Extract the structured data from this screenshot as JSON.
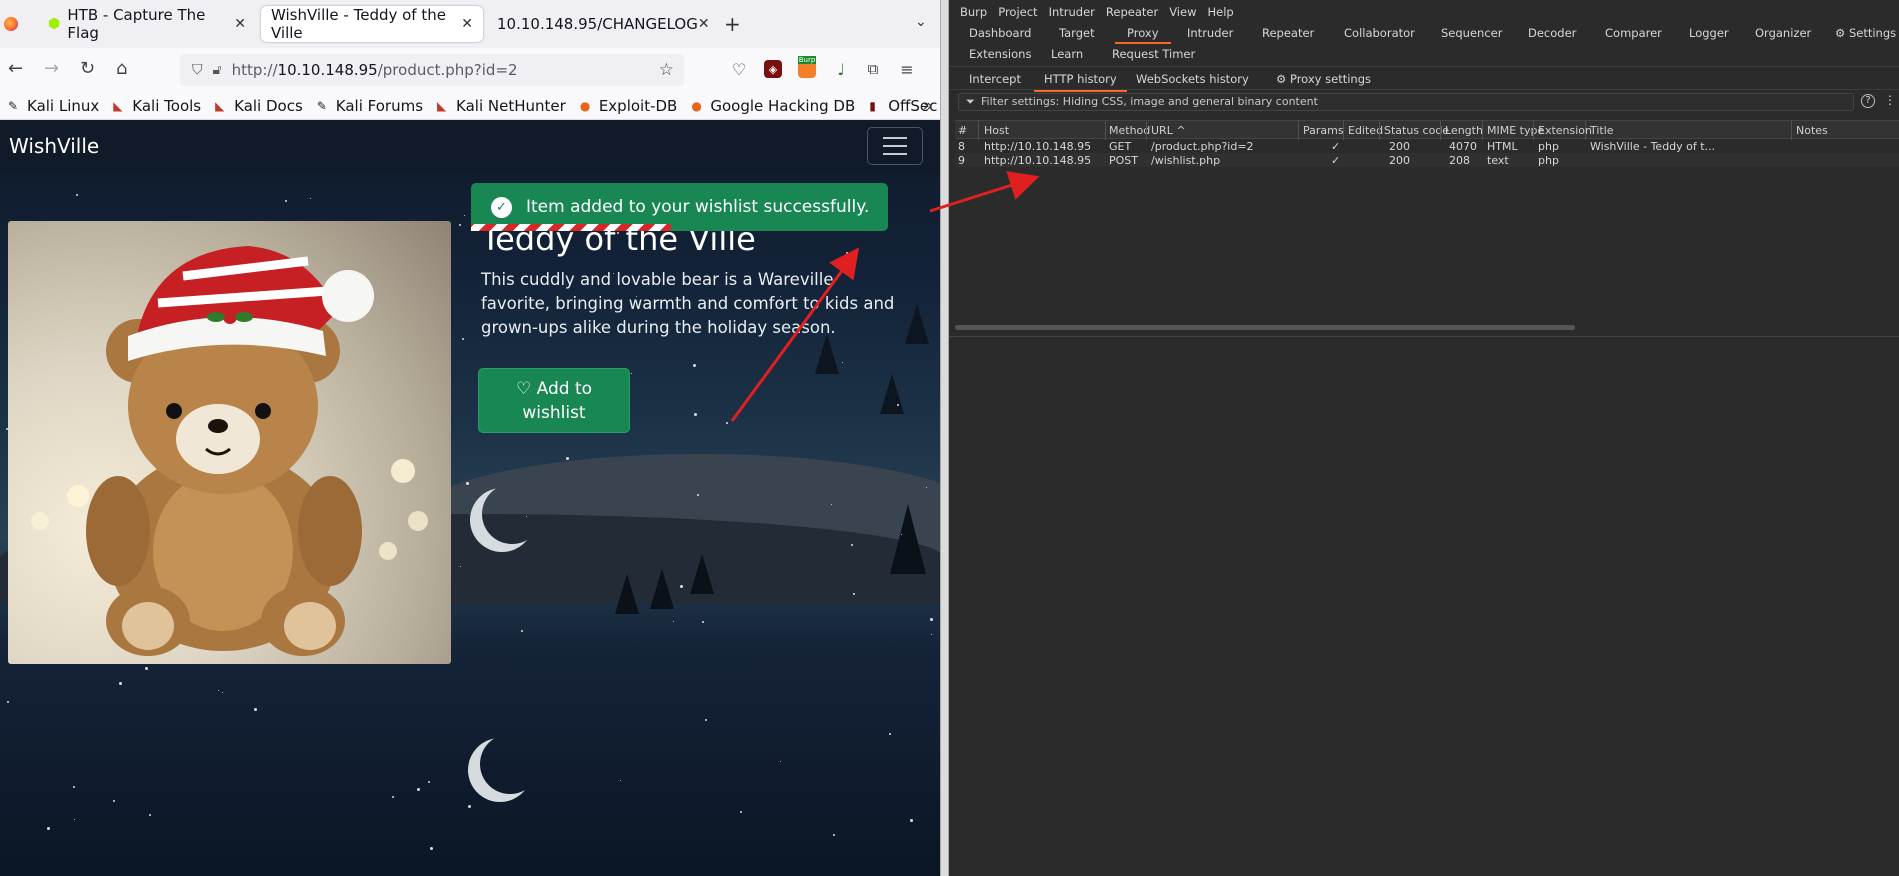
{
  "browser": {
    "tabs": [
      {
        "title": "HTB - Capture The Flag",
        "active": false
      },
      {
        "title": "WishVille - Teddy of the Ville",
        "active": true
      },
      {
        "title": "10.10.148.95/CHANGELOG",
        "active": false
      }
    ],
    "url": {
      "host": "10.10.148.95",
      "prefix": "http://",
      "path": "/product.php?id=2"
    },
    "extension_badge": "Burp",
    "bookmarks": [
      "Kali Linux",
      "Kali Tools",
      "Kali Docs",
      "Kali Forums",
      "Kali NetHunter",
      "Exploit-DB",
      "Google Hacking DB",
      "OffSec"
    ]
  },
  "site": {
    "brand": "WishVille",
    "toast": "Item added to your wishlist successfully.",
    "product_title": "Teddy of the Ville",
    "product_desc": "This cuddly and lovable bear is a Wareville favorite, bringing warmth and comfort to kids and grown-ups alike during the holiday season.",
    "wishlist_line1": "♡ Add to",
    "wishlist_line2": "wishlist"
  },
  "burp": {
    "menu": [
      "Burp",
      "Project",
      "Intruder",
      "Repeater",
      "View",
      "Help"
    ],
    "tool_tabs_row1": [
      "Dashboard",
      "Target",
      "Proxy",
      "Intruder",
      "Repeater",
      "Collaborator",
      "Sequencer",
      "Decoder",
      "Comparer",
      "Logger",
      "Organizer"
    ],
    "settings_label": "Settings",
    "tool_tabs_row2": [
      "Extensions",
      "Learn",
      "Request Timer"
    ],
    "active_tool": "Proxy",
    "sub_tabs": [
      "Intercept",
      "HTTP history",
      "WebSockets history"
    ],
    "active_sub_tab": "HTTP history",
    "proxy_settings": "Proxy settings",
    "filter_text": "Filter settings: Hiding CSS, image and general binary content",
    "columns": [
      "#",
      "Host",
      "Method",
      "URL",
      "Params",
      "Edited",
      "Status code",
      "Length",
      "MIME type",
      "Extension",
      "Title",
      "Notes"
    ],
    "url_sort_indicator": "^",
    "rows": [
      {
        "num": "8",
        "host": "http://10.10.148.95",
        "method": "GET",
        "url": "/product.php?id=2",
        "params": "✓",
        "edited": "",
        "status": "200",
        "length": "4070",
        "mime": "HTML",
        "ext": "php",
        "title": "WishVille - Teddy of t...",
        "notes": ""
      },
      {
        "num": "9",
        "host": "http://10.10.148.95",
        "method": "POST",
        "url": "/wishlist.php",
        "params": "✓",
        "edited": "",
        "status": "200",
        "length": "208",
        "mime": "text",
        "ext": "php",
        "title": "",
        "notes": ""
      }
    ]
  },
  "colors": {
    "toast_green": "#198754",
    "burp_accent": "#f26b2a",
    "annotation_red": "#e02020"
  }
}
